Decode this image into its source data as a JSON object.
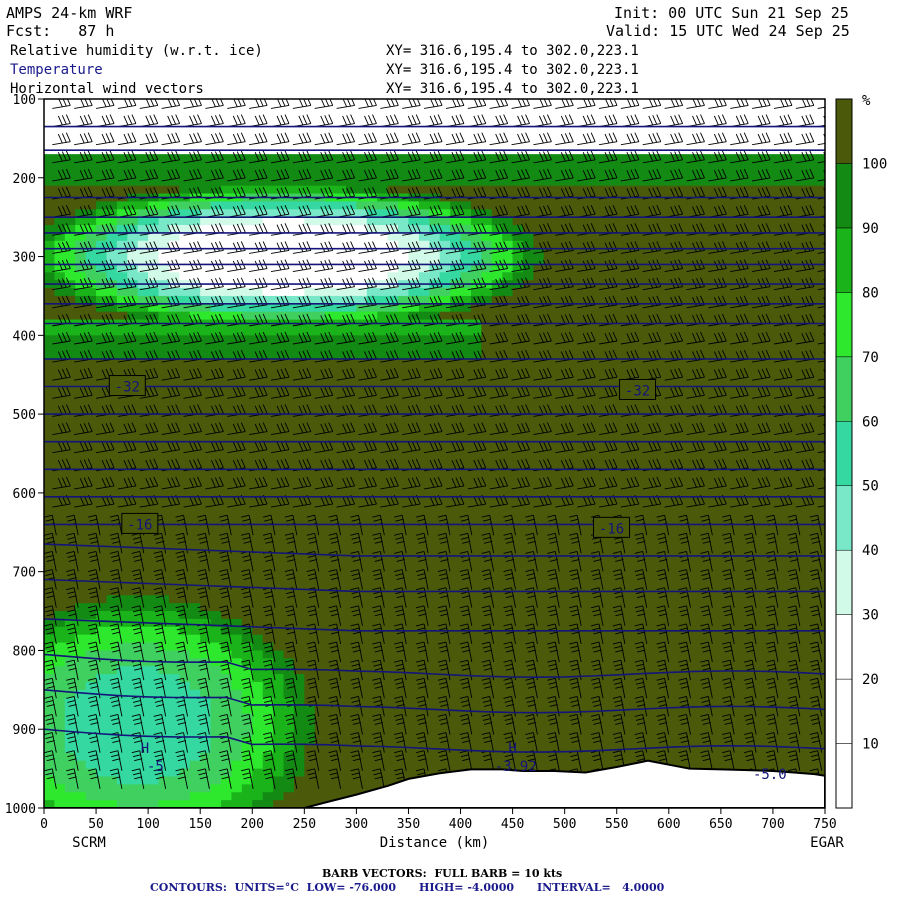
{
  "header": {
    "model": "AMPS 24-km WRF",
    "fcst": "Fcst:   87 h",
    "init": "Init: 00 UTC Sun 21 Sep 25",
    "valid": "Valid: 15 UTC Wed 24 Sep 25",
    "field1": "Relative humidity (w.r.t. ice)",
    "field2": "Temperature",
    "field3": "Horizontal wind vectors",
    "xy1": "XY= 316.6,195.4 to 302.0,223.1",
    "xy2": "XY= 316.6,195.4 to 302.0,223.1",
    "xy3": "XY= 316.6,195.4 to 302.0,223.1"
  },
  "footer": {
    "barb": "BARB VECTORS:  FULL BARB = 10 kts",
    "contours": "CONTOURS:  UNITS=°C  LOW= -76.000      HIGH= -4.0000      INTERVAL=   4.0000"
  },
  "chart_data": {
    "type": "heatmap",
    "xlabel": "Distance (km)",
    "x_ticks": [
      0,
      50,
      100,
      150,
      200,
      250,
      300,
      350,
      400,
      450,
      500,
      550,
      600,
      650,
      700,
      750
    ],
    "xlim": [
      0,
      750
    ],
    "y_ticks": [
      100,
      200,
      300,
      400,
      500,
      600,
      700,
      800,
      900,
      1000
    ],
    "ylim": [
      1000,
      100
    ],
    "endpoint_left": "SCRM",
    "endpoint_right": "EGAR",
    "colorbar": {
      "unit": "%",
      "ticks": [
        10,
        20,
        30,
        40,
        50,
        60,
        70,
        80,
        90,
        100
      ],
      "levels": [
        0,
        10,
        20,
        30,
        40,
        50,
        60,
        70,
        80,
        90,
        100,
        110
      ],
      "colors": [
        "#ffffff",
        "#ffffff",
        "#ffffff",
        "#d2fae8",
        "#78e8c8",
        "#34d8a0",
        "#40d060",
        "#2ee82e",
        "#1ab41a",
        "#138a13",
        "#4a5a0a"
      ]
    },
    "temperature_labels": [
      {
        "text": "-32",
        "x": 80,
        "p": 465
      },
      {
        "text": "-32",
        "x": 570,
        "p": 470
      },
      {
        "text": "-16",
        "x": 92,
        "p": 640
      },
      {
        "text": "-16",
        "x": 545,
        "p": 645
      }
    ],
    "extrema": [
      {
        "text": "H",
        "x": 97,
        "p": 930
      },
      {
        "text": "-5",
        "x": 107,
        "p": 953
      },
      {
        "text": "H",
        "x": 450,
        "p": 930
      },
      {
        "text": "-3.92",
        "x": 453,
        "p": 953
      },
      {
        "text": "-5.0",
        "x": 697,
        "p": 963
      }
    ],
    "terrain": [
      [
        0,
        1000
      ],
      [
        50,
        1000
      ],
      [
        100,
        1000
      ],
      [
        150,
        1000
      ],
      [
        200,
        1000
      ],
      [
        250,
        1000
      ],
      [
        270,
        993
      ],
      [
        300,
        983
      ],
      [
        330,
        972
      ],
      [
        350,
        963
      ],
      [
        380,
        956
      ],
      [
        410,
        951
      ],
      [
        440,
        951
      ],
      [
        460,
        953
      ],
      [
        490,
        953
      ],
      [
        520,
        955
      ],
      [
        550,
        948
      ],
      [
        580,
        940
      ],
      [
        600,
        945
      ],
      [
        620,
        950
      ],
      [
        650,
        951
      ],
      [
        680,
        952
      ],
      [
        700,
        953
      ],
      [
        720,
        955
      ],
      [
        740,
        957
      ],
      [
        750,
        959
      ]
    ],
    "humidity_fields": [
      {
        "name": "band_upper",
        "p_top": 100,
        "p_bot": 165,
        "x0": 0,
        "x1": 750
      },
      {
        "name": "clear_core",
        "x_center": 230,
        "p_center": 300,
        "x_halfwidth": 200,
        "p_halfwidth": 75
      },
      {
        "name": "low_left_moist",
        "x_center": 90,
        "p_center": 895,
        "x_halfwidth": 150,
        "p_halfwidth": 145
      }
    ],
    "isotherm_pressures": [
      135,
      165,
      225,
      250,
      270,
      290,
      310,
      335,
      360,
      385,
      430,
      465,
      500,
      535,
      570,
      605,
      640,
      680,
      725,
      775,
      830,
      875,
      925
    ]
  }
}
